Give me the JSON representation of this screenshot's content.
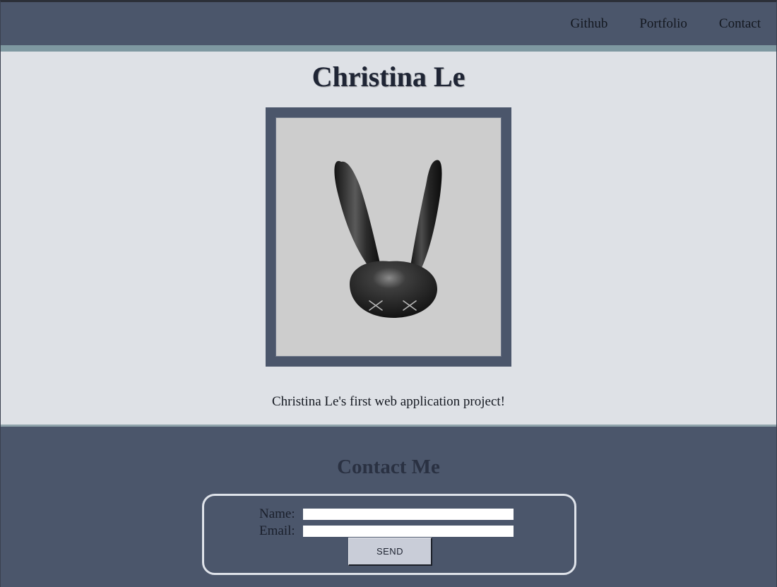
{
  "nav": {
    "items": [
      {
        "label": "Github"
      },
      {
        "label": "Portfolio"
      },
      {
        "label": "Contact"
      }
    ]
  },
  "hero": {
    "title": "Christina Le",
    "image_subject": "bunny-head-icon",
    "caption": "Christina Le's first web application project!"
  },
  "contact": {
    "title": "Contact Me",
    "name_label": "Name:",
    "name_value": "",
    "email_label": "Email:",
    "email_value": "",
    "send_label": "SEND"
  },
  "colors": {
    "header_bg": "#4b566b",
    "accent_rule": "#7e98a1",
    "main_bg": "#dee1e6",
    "title_text": "#1f2535",
    "button_bg": "#c9cdd8"
  }
}
